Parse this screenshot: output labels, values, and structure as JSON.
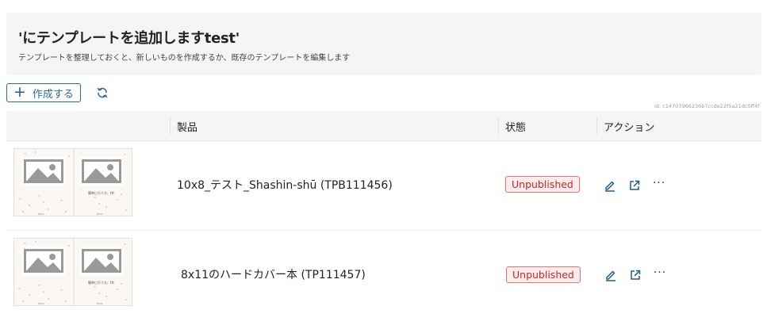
{
  "header": {
    "title": "'にテンプレートを追加しますtest'",
    "subtitle": "テンプレートを整理しておくと、新しいものを作成するか、既存のテンプレートを編集します"
  },
  "toolbar": {
    "create_label": "作成する",
    "create_icon": "plus-icon",
    "refresh_icon": "refresh-icon"
  },
  "id_text": "id: c14707966236b7ccde22f5a21dc0ff4f",
  "table": {
    "columns": [
      "",
      "製品",
      "状態",
      "アクション"
    ],
    "rows": [
      {
        "product": "10x8_テスト_Shashin-shū (TPB111456)",
        "status": "Unpublished",
        "thumb_caption": "簡単に行う方、ttt.",
        "thumb_left_foot": "Emiz",
        "thumb_right_foot": "Emiz"
      },
      {
        "product": "8x11のハードカバー本 (TP111457)",
        "status": "Unpublished",
        "thumb_caption": "簡単に行う方、ttt.",
        "thumb_left_foot": "Emiz",
        "thumb_right_foot": "Emiz"
      }
    ]
  },
  "colors": {
    "accent": "#2a6b8f",
    "badge_border": "#e57373",
    "badge_text": "#c62828",
    "header_bg": "#f5f5f5"
  }
}
